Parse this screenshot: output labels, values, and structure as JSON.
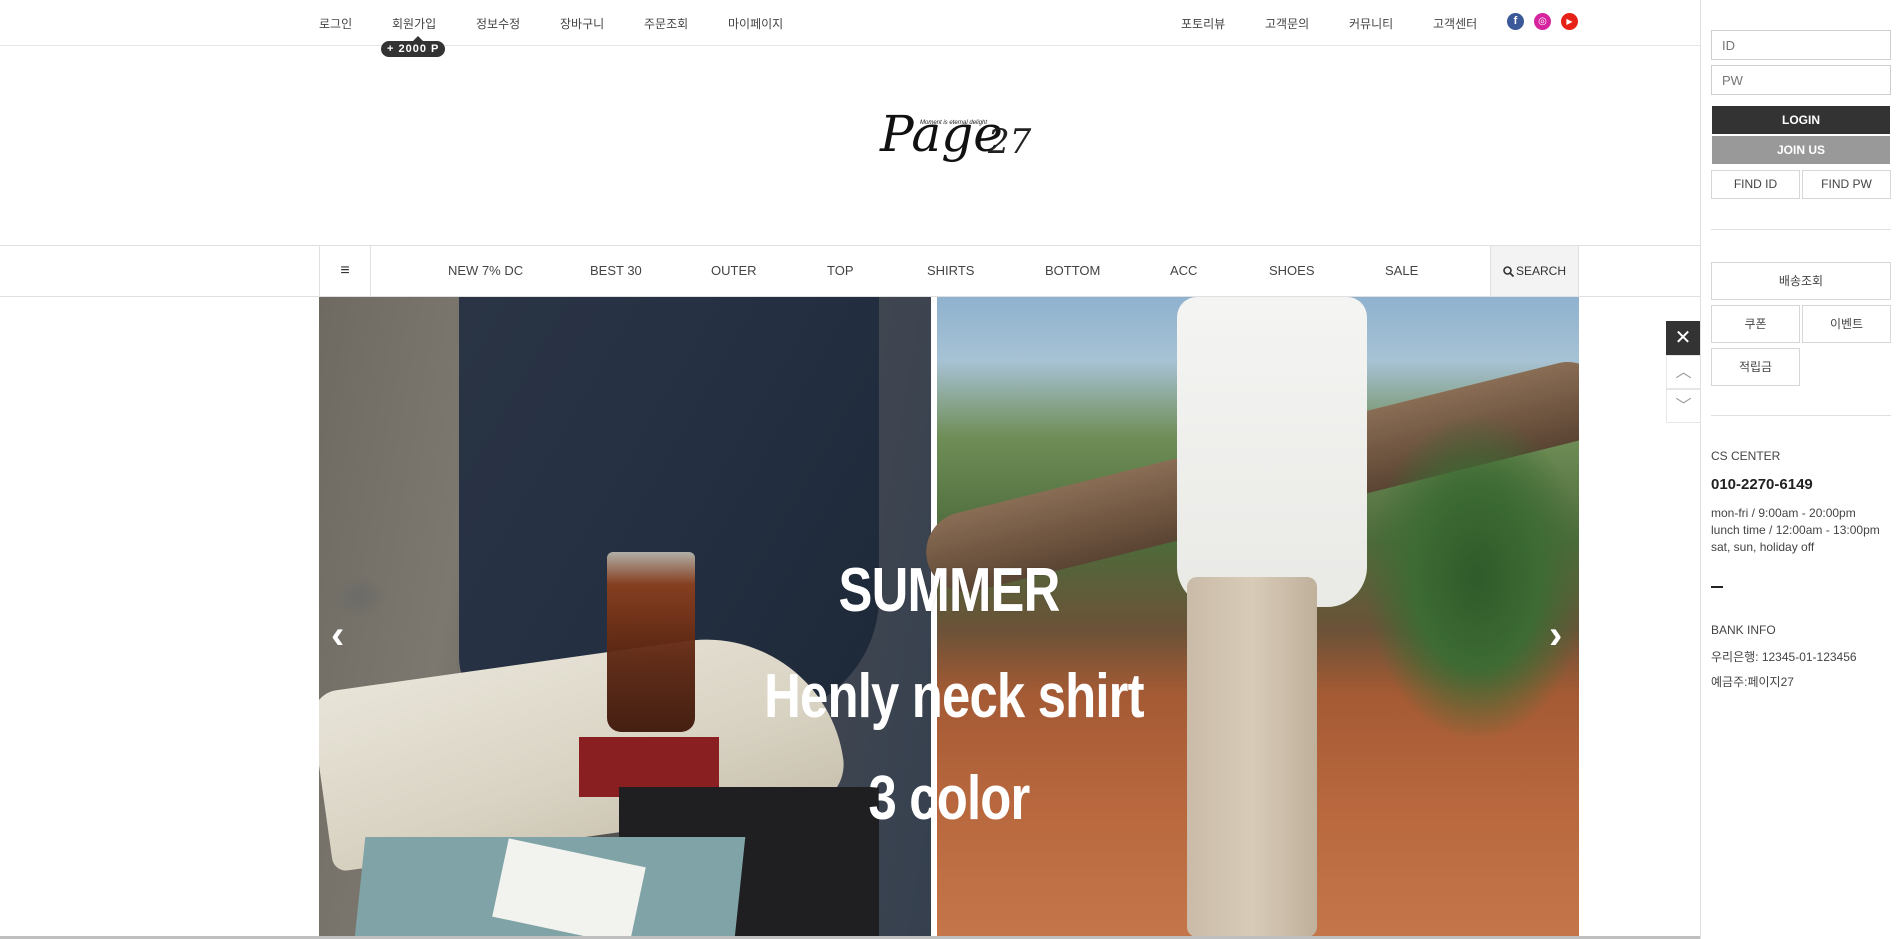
{
  "topbar": {
    "left_links": [
      "로그인",
      "회원가입",
      "정보수정",
      "장바구니",
      "주문조회",
      "마이페이지"
    ],
    "point_badge": "+ 2000 P",
    "right_links": [
      "포토리뷰",
      "고객문의",
      "커뮤니티",
      "고객센터"
    ],
    "social_icons": [
      {
        "name": "facebook-icon",
        "glyph": "f",
        "color": "#3b5998"
      },
      {
        "name": "instagram-icon",
        "glyph": "◎",
        "color": "#d6249f"
      },
      {
        "name": "youtube-icon",
        "glyph": "▶",
        "color": "#e62117"
      }
    ]
  },
  "logo": {
    "text": "Page",
    "number": "27",
    "tagline": "Moment is eternal delight"
  },
  "nav": {
    "menu_icon": "≡",
    "items": [
      "NEW 7% DC",
      "BEST 30",
      "OUTER",
      "TOP",
      "SHIRTS",
      "BOTTOM",
      "ACC",
      "SHOES",
      "SALE"
    ],
    "search_label": "SEARCH"
  },
  "hero": {
    "line1": "SUMMER",
    "line2": "Henly neck shirt",
    "line3": "3 color",
    "prev_arrow": "‹",
    "next_arrow": "›"
  },
  "float_widget": {
    "close_glyph": "✕",
    "up_glyph": "︿",
    "down_glyph": "﹀"
  },
  "sidebar": {
    "id_placeholder": "ID",
    "pw_placeholder": "PW",
    "login_label": "LOGIN",
    "join_label": "JOIN US",
    "find_id_label": "FIND ID",
    "find_pw_label": "FIND PW",
    "delivery_label": "배송조회",
    "coupon_label": "쿠폰",
    "event_label": "이벤트",
    "points_label": "적립금",
    "cs_title": "CS CENTER",
    "cs_phone": "010-2270-6149",
    "cs_hours": [
      "mon-fri / 9:00am - 20:00pm",
      "lunch time / 12:00am - 13:00pm",
      "sat, sun, holiday off"
    ],
    "bank_title": "BANK INFO",
    "bank_account": "우리은행: 12345-01-123456",
    "bank_holder": "예금주:페이지27"
  },
  "colors": {
    "login_bg": "#333333",
    "join_bg": "#999999"
  }
}
